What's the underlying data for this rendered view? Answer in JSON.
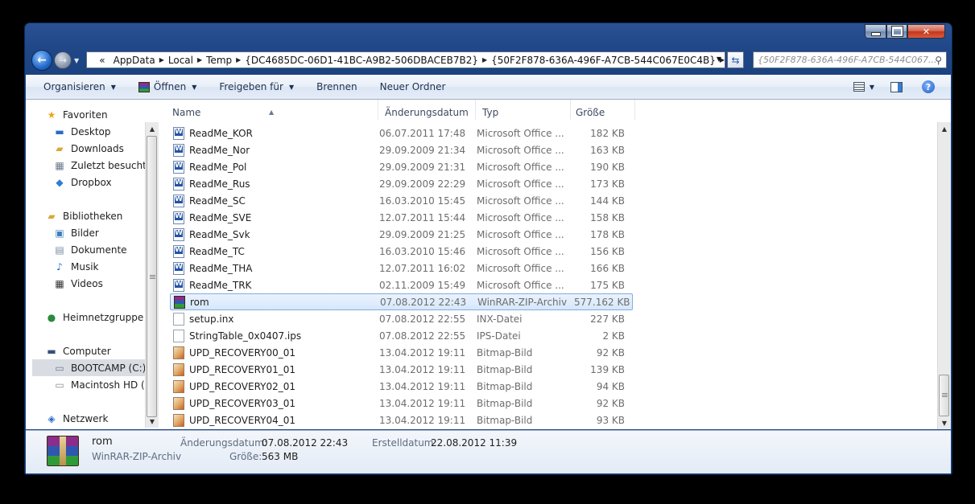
{
  "address": {
    "crumbs": [
      "«",
      "AppData",
      "Local",
      "Temp",
      "{DC4685DC-06D1-41BC-A9B2-506DBACEB7B2}",
      "{50F2F878-636A-496F-A7CB-544C067E0C4B}"
    ]
  },
  "search": {
    "placeholder": "{50F2F878-636A-496F-A7CB-544C067..."
  },
  "toolbar": {
    "organize": "Organisieren",
    "open": "Öffnen",
    "share": "Freigeben für",
    "burn": "Brennen",
    "new_folder": "Neuer Ordner"
  },
  "nav": {
    "favorites": "Favoriten",
    "desktop": "Desktop",
    "downloads": "Downloads",
    "recent": "Zuletzt besucht",
    "dropbox": "Dropbox",
    "libraries": "Bibliotheken",
    "pictures": "Bilder",
    "documents": "Dokumente",
    "music": "Musik",
    "videos": "Videos",
    "homegroup": "Heimnetzgruppe",
    "computer": "Computer",
    "bootcamp": "BOOTCAMP (C:)",
    "macintosh": "Macintosh HD (E",
    "network": "Netzwerk"
  },
  "columns": {
    "name": "Name",
    "date": "Änderungsdatum",
    "type": "Typ",
    "size": "Größe"
  },
  "files": [
    {
      "name": "ReadMe_KOR",
      "date": "06.07.2011 17:48",
      "type": "Microsoft Office ...",
      "size": "182 KB",
      "icon": "word-doc-icon"
    },
    {
      "name": "ReadMe_Nor",
      "date": "29.09.2009 21:34",
      "type": "Microsoft Office ...",
      "size": "163 KB",
      "icon": "word-doc-icon"
    },
    {
      "name": "ReadMe_Pol",
      "date": "29.09.2009 21:31",
      "type": "Microsoft Office ...",
      "size": "190 KB",
      "icon": "word-doc-icon"
    },
    {
      "name": "ReadMe_Rus",
      "date": "29.09.2009 22:29",
      "type": "Microsoft Office ...",
      "size": "173 KB",
      "icon": "word-doc-icon"
    },
    {
      "name": "ReadMe_SC",
      "date": "16.03.2010 15:45",
      "type": "Microsoft Office ...",
      "size": "144 KB",
      "icon": "word-doc-icon"
    },
    {
      "name": "ReadMe_SVE",
      "date": "12.07.2011 15:44",
      "type": "Microsoft Office ...",
      "size": "158 KB",
      "icon": "word-doc-icon"
    },
    {
      "name": "ReadMe_Svk",
      "date": "29.09.2009 21:25",
      "type": "Microsoft Office ...",
      "size": "178 KB",
      "icon": "word-doc-icon"
    },
    {
      "name": "ReadMe_TC",
      "date": "16.03.2010 15:46",
      "type": "Microsoft Office ...",
      "size": "156 KB",
      "icon": "word-doc-icon"
    },
    {
      "name": "ReadMe_THA",
      "date": "12.07.2011 16:02",
      "type": "Microsoft Office ...",
      "size": "166 KB",
      "icon": "word-doc-icon"
    },
    {
      "name": "ReadMe_TRK",
      "date": "02.11.2009 15:49",
      "type": "Microsoft Office ...",
      "size": "175 KB",
      "icon": "word-doc-icon"
    },
    {
      "name": "rom",
      "date": "07.08.2012 22:43",
      "type": "WinRAR-ZIP-Archiv",
      "size": "577.162 KB",
      "icon": "winrar-archive-icon"
    },
    {
      "name": "setup.inx",
      "date": "07.08.2012 22:55",
      "type": "INX-Datei",
      "size": "227 KB",
      "icon": "blank-file-icon"
    },
    {
      "name": "StringTable_0x0407.ips",
      "date": "07.08.2012 22:55",
      "type": "IPS-Datei",
      "size": "2 KB",
      "icon": "blank-file-icon"
    },
    {
      "name": "UPD_RECOVERY00_01",
      "date": "13.04.2012 19:11",
      "type": "Bitmap-Bild",
      "size": "92 KB",
      "icon": "bitmap-image-icon"
    },
    {
      "name": "UPD_RECOVERY01_01",
      "date": "13.04.2012 19:11",
      "type": "Bitmap-Bild",
      "size": "139 KB",
      "icon": "bitmap-image-icon"
    },
    {
      "name": "UPD_RECOVERY02_01",
      "date": "13.04.2012 19:11",
      "type": "Bitmap-Bild",
      "size": "94 KB",
      "icon": "bitmap-image-icon"
    },
    {
      "name": "UPD_RECOVERY03_01",
      "date": "13.04.2012 19:11",
      "type": "Bitmap-Bild",
      "size": "92 KB",
      "icon": "bitmap-image-icon"
    },
    {
      "name": "UPD_RECOVERY04_01",
      "date": "13.04.2012 19:11",
      "type": "Bitmap-Bild",
      "size": "93 KB",
      "icon": "bitmap-image-icon"
    }
  ],
  "selected_index": 10,
  "details": {
    "name": "rom",
    "type": "WinRAR-ZIP-Archiv",
    "modified_label": "Änderungsdatum:",
    "modified": "07.08.2012 22:43",
    "created_label": "Erstelldatum:",
    "created": "22.08.2012 11:39",
    "size_label": "Größe:",
    "size": "563 MB"
  }
}
